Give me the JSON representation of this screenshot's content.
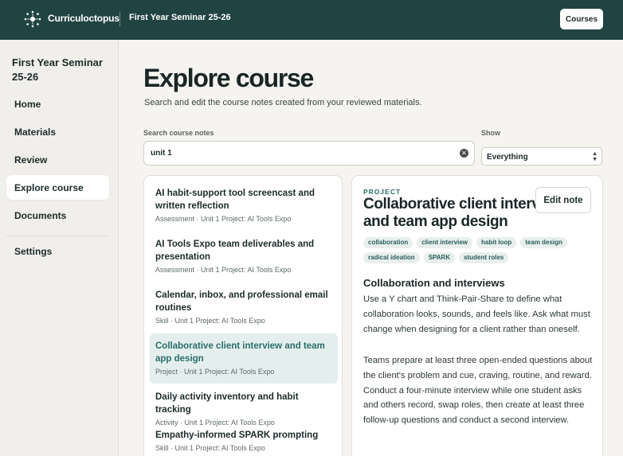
{
  "header": {
    "brand": "Curriculoctopus",
    "course_title": "First Year Seminar 25-26",
    "courses_button": "Courses"
  },
  "sidebar": {
    "title": "First Year Seminar 25-26",
    "items": [
      {
        "label": "Home"
      },
      {
        "label": "Materials"
      },
      {
        "label": "Review"
      },
      {
        "label": "Explore course",
        "active": true
      },
      {
        "label": "Documents"
      },
      {
        "label": "Settings"
      }
    ]
  },
  "main": {
    "title": "Explore course",
    "subtitle": "Search and edit the course notes created from your reviewed materials.",
    "search_label": "Search course notes",
    "search_value": "unit 1",
    "show_label": "Show",
    "show_value": "Everything"
  },
  "results": [
    {
      "title": "AI habit-support tool screencast and written reflection",
      "meta": "Assessment · Unit 1 Project: AI Tools Expo"
    },
    {
      "title": "AI Tools Expo team deliverables and presentation",
      "meta": "Assessment · Unit 1 Project: AI Tools Expo"
    },
    {
      "title": "Calendar, inbox, and professional email routines",
      "meta": "Skill · Unit 1 Project: AI Tools Expo"
    },
    {
      "title": "Collaborative client interview and team app design",
      "meta": "Project · Unit 1 Project: AI Tools Expo",
      "selected": true
    },
    {
      "title": "Daily activity inventory and habit tracking",
      "meta": "Activity · Unit 1 Project: AI Tools Expo"
    },
    {
      "title": "Empathy-informed SPARK prompting",
      "meta": "Skill · Unit 1 Project: AI Tools Expo"
    }
  ],
  "detail": {
    "kicker": "PROJECT",
    "title": "Collaborative client interview and team app design",
    "edit_button": "Edit note",
    "tags": [
      "collaboration",
      "client interview",
      "habit loop",
      "team design",
      "radical ideation",
      "SPARK",
      "student roles"
    ],
    "section_heading": "Collaboration and interviews",
    "paragraphs": [
      "Use a Y chart and Think-Pair-Share to define what collaboration looks, sounds, and feels like. Ask what must change when designing for a client rather than oneself.",
      "Teams prepare at least three open-ended questions about the client's problem and cue, craving, routine, and reward. Conduct a four-minute interview while one student asks and others record, swap roles, then create at least three follow-up questions and conduct a second interview."
    ]
  },
  "colors": {
    "header_bg": "#214443",
    "accent": "#2b6e67",
    "selected_bg": "#e4efed"
  }
}
